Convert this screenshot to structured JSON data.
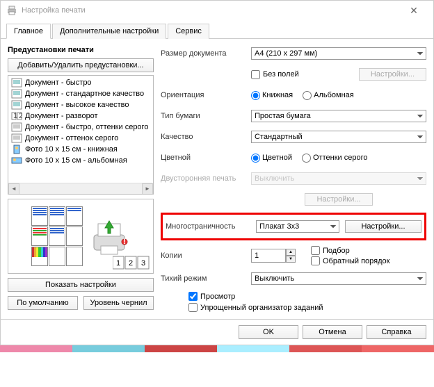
{
  "window": {
    "title": "Настройка печати"
  },
  "tabs": {
    "main": "Главное",
    "advanced": "Дополнительные настройки",
    "service": "Сервис"
  },
  "left": {
    "presets_title": "Предустановки печати",
    "add_remove_btn": "Добавить/Удалить предустановки...",
    "items": [
      "Документ - быстро",
      "Документ - стандартное качество",
      "Документ - высокое качество",
      "Документ - разворот",
      "Документ - быстро, оттенки серого",
      "Документ - оттенок серого",
      "Фото 10 x 15 см - книжная",
      "Фото 10 x 15 см - альбомная"
    ],
    "show_btn": "Показать настройки",
    "default_btn": "По умолчанию",
    "ink_btn": "Уровень чернил"
  },
  "labels": {
    "doc_size": "Размер документа",
    "borderless": "Без полей",
    "settings": "Настройки...",
    "orientation": "Ориентация",
    "portrait": "Книжная",
    "landscape": "Альбомная",
    "paper_type": "Тип бумаги",
    "quality": "Качество",
    "color_lbl": "Цветной",
    "color_opt": "Цветной",
    "grayscale_opt": "Оттенки серого",
    "duplex": "Двусторонняя печать",
    "multipage": "Многостраничность",
    "copies": "Копии",
    "collate": "Подбор",
    "reverse": "Обратный порядок",
    "quiet": "Тихий режим",
    "preview": "Просмотр",
    "simple_org": "Упрощенный организатор заданий"
  },
  "values": {
    "doc_size": "A4 (210 x 297 мм)",
    "paper_type": "Простая бумага",
    "quality": "Стандартный",
    "duplex": "Выключить",
    "multipage": "Плакат 3x3",
    "copies": "1",
    "quiet": "Выключить"
  },
  "footer": {
    "ok": "OK",
    "cancel": "Отмена",
    "help": "Справка"
  }
}
